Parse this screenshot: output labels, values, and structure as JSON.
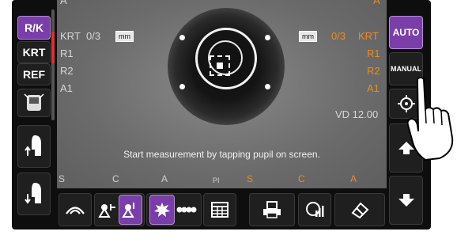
{
  "left_panel": {
    "rk_label": "R/K",
    "krt_label": "KRT",
    "ref_label": "REF"
  },
  "right_panel": {
    "auto_label": "AUTO",
    "manual_label": "MANUAL"
  },
  "overlay": {
    "top_left_a": "A",
    "krt_left": "KRT",
    "count_left": "0/3",
    "mm_badge": "mm",
    "r1_left": "R1",
    "r2_left": "R2",
    "a1_left": "A1",
    "mm_badge_right": "mm",
    "count_right": "0/3",
    "krt_right": "KRT",
    "r1_right": "R1",
    "r2_right": "R2",
    "a1_right": "A1",
    "top_right_a": "A",
    "vd": "VD 12.00",
    "message": "Start measurement by tapping pupil on screen."
  },
  "bottom_labels": {
    "s_white": "S",
    "c_white": "C",
    "a_white": "A",
    "pi": "PI",
    "s_orange": "S",
    "c_orange": "C",
    "a_orange": "A"
  },
  "colors": {
    "accent_purple": "#7a3ea8",
    "orange": "#f08a1c"
  }
}
